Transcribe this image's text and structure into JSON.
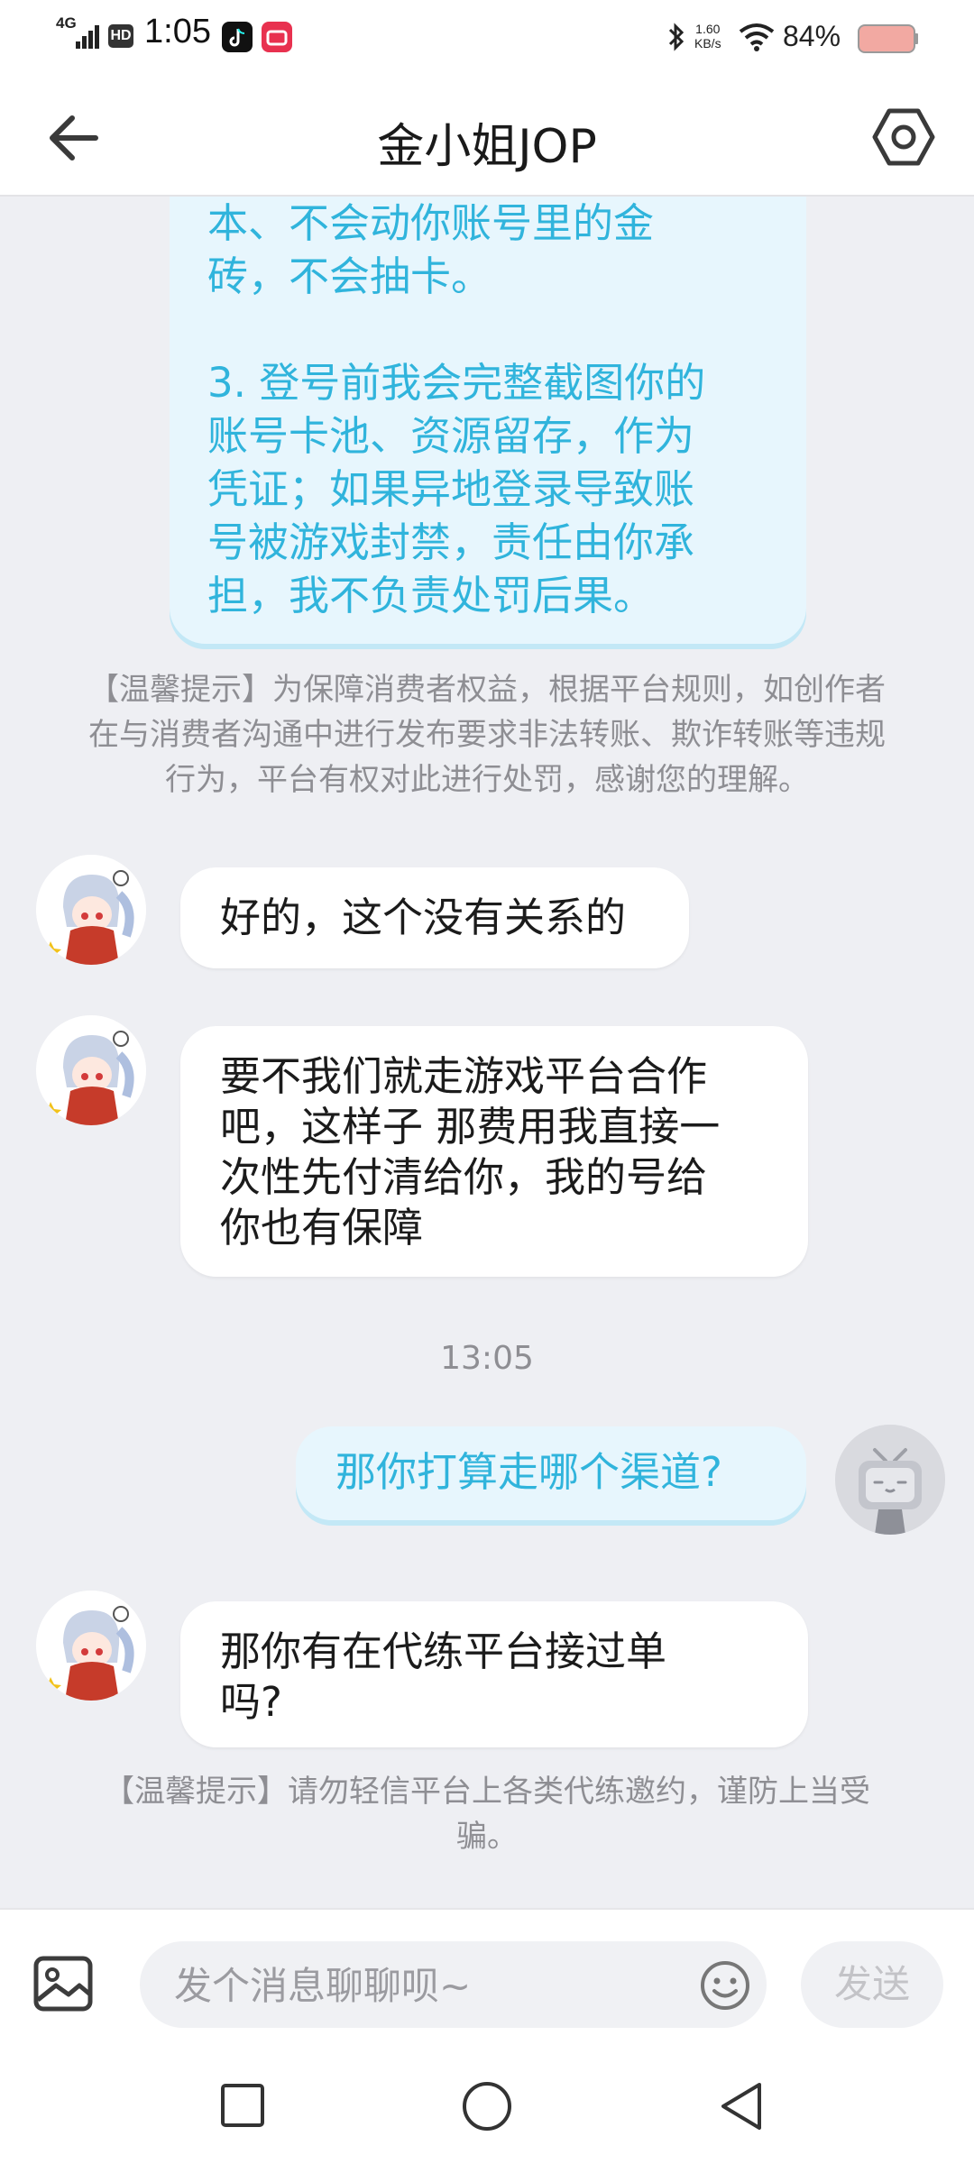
{
  "status_bar": {
    "time": "1:05",
    "network": "4G",
    "hd_badge": "HD",
    "speed_value": "1.60",
    "speed_unit": "KB/s",
    "battery_percent": "84%",
    "battery_color": "#f2a9a2"
  },
  "header": {
    "title": "金小姐JOP",
    "back_icon": "arrow-left-icon",
    "settings_icon": "hexagon-settings-icon"
  },
  "messages": {
    "outgoing_long": [
      "本、不会动你账号里的金",
      "砖，不会抽卡。",
      "",
      "3. 登号前我会完整截图你的",
      "账号卡池、资源留存，作为",
      "凭证；如果异地登录导致账",
      "号被游戏封禁，责任由你承",
      "担，我不负责处罚后果。"
    ],
    "tip_1": [
      "【温馨提示】为保障消费者权益，根据平台规则，如创作者",
      "在与消费者沟通中进行发布要求非法转账、欺诈转账等违规",
      "行为，平台有权对此进行处罚，感谢您的理解。"
    ],
    "incoming_1": "好的，这个没有关系的",
    "incoming_2": [
      "要不我们就走游戏平台合作",
      "吧，这样子 那费用我直接一",
      "次性先付清给你，我的号给",
      "你也有保障"
    ],
    "time_separator": "13:05",
    "outgoing_short": "那你打算走哪个渠道?",
    "incoming_3": [
      "那你有在代练平台接过单",
      "吗?"
    ],
    "tip_2": [
      "【温馨提示】请勿轻信平台上各类代练邀约，谨防上当受",
      "骗。"
    ]
  },
  "input_bar": {
    "placeholder": "发个消息聊聊呗~",
    "send_label": "发送",
    "image_icon": "image-icon",
    "emoji_icon": "emoji-icon"
  },
  "colors": {
    "accent": "#30b4dc",
    "outgoing_bubble": "#e7f6fd",
    "chat_background": "#eeeff3"
  }
}
